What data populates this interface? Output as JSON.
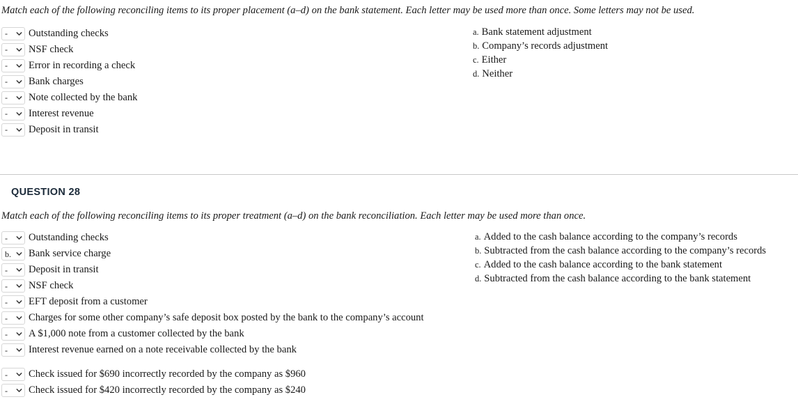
{
  "colors": {
    "page_background": "#ffffff",
    "text": "#1a1a1a",
    "heading": "#1c2b3a",
    "divider": "#c9c9c9",
    "select_border": "#d6d6d6"
  },
  "question_27": {
    "prompt": "Match each of the following reconciling items to its proper placement (a–d) on the bank statement. Each letter may be used more than once. Some letters may not be used.",
    "items": [
      {
        "value": "-",
        "label": "Outstanding checks"
      },
      {
        "value": "-",
        "label": "NSF check"
      },
      {
        "value": "-",
        "label": "Error in recording a check"
      },
      {
        "value": "-",
        "label": "Bank charges"
      },
      {
        "value": "-",
        "label": "Note collected by the bank"
      },
      {
        "value": "-",
        "label": "Interest revenue"
      },
      {
        "value": "-",
        "label": "Deposit in transit"
      }
    ],
    "options": [
      {
        "letter": "a.",
        "text": "Bank statement adjustment"
      },
      {
        "letter": "b.",
        "text": "Company’s records adjustment"
      },
      {
        "letter": "c.",
        "text": "Either"
      },
      {
        "letter": "d.",
        "text": "Neither"
      }
    ]
  },
  "question_28": {
    "heading": "QUESTION 28",
    "prompt": "Match each of the following reconciling items to its proper treatment (a–d) on the bank reconciliation. Each letter may be used more than once.",
    "items": [
      {
        "value": "-",
        "label": "Outstanding checks"
      },
      {
        "value": "b.",
        "label": "Bank service charge"
      },
      {
        "value": "-",
        "label": "Deposit in transit"
      },
      {
        "value": "-",
        "label": "NSF check"
      },
      {
        "value": "-",
        "label": "EFT deposit from a customer"
      },
      {
        "value": "-",
        "label": "Charges for some other company’s safe deposit box posted by the bank to the company’s account"
      },
      {
        "value": "-",
        "label": "A $1,000 note from a customer collected by the bank"
      },
      {
        "value": "-",
        "label": "Interest revenue earned on a note receivable collected by the bank"
      },
      {
        "value": "-",
        "label": "Check issued for $690 incorrectly recorded by the company as $960"
      },
      {
        "value": "-",
        "label": "Check issued for $420 incorrectly recorded by the company as $240"
      }
    ],
    "options": [
      {
        "letter": "a.",
        "text": "Added to the cash balance according to the company’s records"
      },
      {
        "letter": "b.",
        "text": "Subtracted from the cash balance according to the company’s records"
      },
      {
        "letter": "c.",
        "text": "Added to the cash balance according to the bank statement"
      },
      {
        "letter": "d.",
        "text": "Subtracted from the cash balance according to the bank statement"
      }
    ]
  }
}
